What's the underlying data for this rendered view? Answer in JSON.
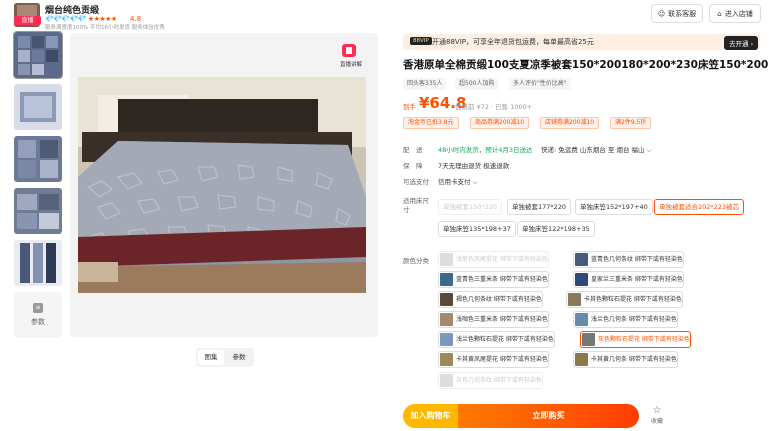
{
  "shop": {
    "name": "烟台纯色贡缎",
    "live_badge": "直播",
    "rating_stars": "★★★★★",
    "diamonds": "💎💎💎💎💎",
    "score": "4.8",
    "meta": "服务满意度100%  平均16小时发货  服务体验优秀",
    "btn_contact": "联系客服",
    "btn_enter": "进入店铺"
  },
  "gallery": {
    "live_label": "直播讲解",
    "param_label": "参数",
    "tabs": [
      "图集",
      "参数"
    ]
  },
  "vip": {
    "tag": "88VIP",
    "text": "开通88VIP，可享全年退货包运费，每单最高省25元",
    "btn": "去开通 ›"
  },
  "product": {
    "title": "香港原单全棉贡缎100支夏凉季被套150*200180*200*230床笠150*200",
    "chips": [
      "回头客335人",
      "超500人加购",
      "多人评价\"性价比高\""
    ]
  },
  "price": {
    "label": "到手",
    "value": "¥64.8",
    "orig": "优惠前 ¥72 · 已售 1000+"
  },
  "coupons": [
    "淘金币已抵3.8元",
    "商品券满200减10",
    "店铺券满200减10",
    "满2件9.5折"
  ],
  "delivery": {
    "label": "配　送",
    "ship": "48小时内发货，预计4月3日送达",
    "method": "快递: 免运费  山东烟台 至 烟台 福山 ⌵"
  },
  "guarantee": {
    "label": "保　障",
    "text": "7天无理由退货  极速退款"
  },
  "payment": {
    "label": "可选支付",
    "text": "信用卡支付 ⌵"
  },
  "size": {
    "label": "适用床尺寸",
    "options": [
      "单独被套150*220",
      "单独被套177*220",
      "单独床笠152*197+40",
      "单独被套适合202*223被芯",
      "单独床笠135*198+37",
      "单独床笠122*198+35"
    ]
  },
  "color": {
    "label": "颜色分类",
    "options": [
      "浅紫色凤尾提花 绑带下或有轻染色",
      "蓝青色几何条纹 绑带下或有轻染色",
      "蓝青色三重米条 绑带下或有轻染色",
      "皇家兰三重米条 绑带下或有轻染色",
      "褐色几何条纹 绑带下或有轻染色",
      "卡其色颗粒石提花 绑带下或有轻染色",
      "浅咖色三重米条 绑带下或有轻染色",
      "浅兰色几何条 绑带下或有轻染色",
      "浅兰色颗粒石提花 绑带下或有轻染色",
      "灰色颗粒石提花 绑带下或有轻染色",
      "卡其黄凤尾提花 绑带下或有轻染色",
      "卡其黄几何条 绑带下或有轻染色",
      "灰色几何条纹 绑带下或有轻染色"
    ]
  },
  "actions": {
    "cart": "加入购物车",
    "buy": "立即购买",
    "fav": "收藏"
  },
  "colors": {
    "accent": "#ff5000",
    "live": "#ff2d55",
    "cart": "#ffb800"
  }
}
